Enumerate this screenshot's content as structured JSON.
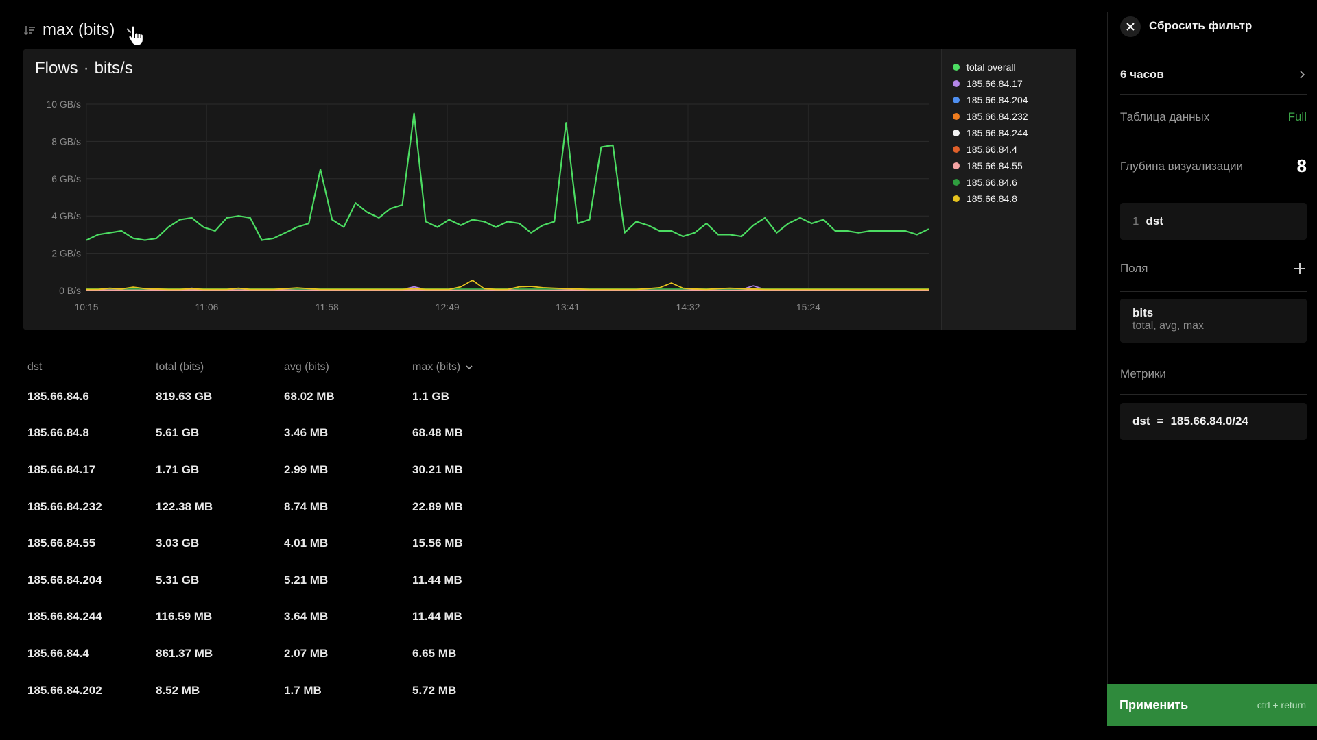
{
  "header": {
    "title": "max (bits)",
    "sort_icon": "sort-desc-icon",
    "chevron_icon": "chevron-down-icon"
  },
  "chart_data": {
    "type": "line",
    "title": "Flows",
    "unit": "bits/s",
    "x_ticks": [
      "10:15",
      "11:06",
      "11:58",
      "12:49",
      "13:41",
      "14:32",
      "15:24"
    ],
    "y_ticks": [
      "0 B/s",
      "2 GB/s",
      "4 GB/s",
      "6 GB/s",
      "8 GB/s",
      "10 GB/s"
    ],
    "ylim": [
      0,
      10
    ],
    "grid": true,
    "legend_position": "right",
    "series": [
      {
        "name": "total overall",
        "color": "#4cdc62",
        "values": [
          2.7,
          3.0,
          3.1,
          3.2,
          2.8,
          2.7,
          2.8,
          3.4,
          3.8,
          3.9,
          3.4,
          3.2,
          3.9,
          4.0,
          3.9,
          2.7,
          2.8,
          3.1,
          3.4,
          3.6,
          6.5,
          3.8,
          3.4,
          4.7,
          4.2,
          3.9,
          4.4,
          4.6,
          9.5,
          3.7,
          3.4,
          3.8,
          3.5,
          3.8,
          3.7,
          3.4,
          3.7,
          3.6,
          3.1,
          3.5,
          3.7,
          9.0,
          3.6,
          3.8,
          7.7,
          7.8,
          3.1,
          3.7,
          3.5,
          3.2,
          3.2,
          2.9,
          3.1,
          3.6,
          3.0,
          3.0,
          2.9,
          3.5,
          3.9,
          3.1,
          3.6,
          3.9,
          3.6,
          3.8,
          3.2,
          3.2,
          3.1,
          3.2,
          3.2,
          3.2,
          3.2,
          3.0,
          3.3
        ]
      },
      {
        "name": "185.66.84.17",
        "color": "#b486e8",
        "values": [
          0.05,
          0.05,
          0.08,
          0.05,
          0.06,
          0.05,
          0.1,
          0.05,
          0.05,
          0.12,
          0.05,
          0.06,
          0.05,
          0.08,
          0.05,
          0.05,
          0.05,
          0.07,
          0.05,
          0.05,
          0.05,
          0.05,
          0.05,
          0.05,
          0.05,
          0.05,
          0.05,
          0.05,
          0.2,
          0.05,
          0.05,
          0.05,
          0.05,
          0.05,
          0.05,
          0.05,
          0.05,
          0.05,
          0.05,
          0.05,
          0.05,
          0.05,
          0.05,
          0.05,
          0.05,
          0.05,
          0.05,
          0.05,
          0.05,
          0.05,
          0.05,
          0.05,
          0.08,
          0.05,
          0.05,
          0.05,
          0.05,
          0.25,
          0.05,
          0.05,
          0.05,
          0.05,
          0.05,
          0.05,
          0.05,
          0.05,
          0.05,
          0.05,
          0.05,
          0.05,
          0.05,
          0.05,
          0.05
        ]
      },
      {
        "name": "185.66.84.204",
        "color": "#4f8ff0",
        "values": [
          0.02,
          0.02,
          0.02,
          0.02,
          0.02,
          0.02,
          0.02,
          0.02,
          0.02,
          0.02,
          0.02,
          0.02,
          0.02,
          0.02,
          0.02,
          0.02,
          0.02,
          0.02,
          0.02,
          0.02,
          0.02,
          0.02,
          0.02,
          0.02,
          0.02,
          0.02,
          0.02,
          0.02,
          0.02,
          0.02,
          0.02,
          0.02,
          0.02,
          0.02,
          0.02,
          0.02,
          0.02,
          0.02,
          0.02,
          0.02,
          0.02,
          0.02,
          0.02,
          0.02,
          0.02,
          0.02,
          0.02,
          0.02,
          0.02,
          0.02,
          0.02,
          0.02,
          0.02,
          0.02,
          0.02,
          0.02,
          0.02,
          0.02,
          0.02,
          0.02,
          0.02,
          0.02,
          0.02,
          0.02,
          0.02,
          0.02,
          0.05,
          0.08,
          0.05,
          0.06,
          0.05,
          0.08,
          0.05
        ]
      },
      {
        "name": "185.66.84.232",
        "color": "#f07d1f",
        "values": [
          0.03,
          0.03,
          0.06,
          0.03,
          0.05,
          0.03,
          0.04,
          0.03,
          0.03,
          0.05,
          0.03,
          0.03,
          0.03,
          0.05,
          0.03,
          0.03,
          0.03,
          0.04,
          0.03,
          0.03,
          0.03,
          0.03,
          0.03,
          0.03,
          0.03,
          0.03,
          0.03,
          0.03,
          0.05,
          0.03,
          0.03,
          0.03,
          0.03,
          0.03,
          0.03,
          0.03,
          0.04,
          0.03,
          0.03,
          0.03,
          0.03,
          0.05,
          0.03,
          0.03,
          0.03,
          0.03,
          0.03,
          0.03,
          0.03,
          0.03,
          0.03,
          0.03,
          0.05,
          0.03,
          0.03,
          0.03,
          0.03,
          0.04,
          0.03,
          0.03,
          0.03,
          0.03,
          0.03,
          0.03,
          0.03,
          0.03,
          0.03,
          0.03,
          0.03,
          0.03,
          0.03,
          0.03,
          0.03
        ]
      },
      {
        "name": "185.66.84.244",
        "color": "#f2f2f2",
        "values": [
          0.02,
          0.02,
          0.02,
          0.02,
          0.02,
          0.02,
          0.02,
          0.02,
          0.02,
          0.02,
          0.02,
          0.02,
          0.02,
          0.02,
          0.02,
          0.02,
          0.02,
          0.02,
          0.02,
          0.02,
          0.02,
          0.02,
          0.02,
          0.02,
          0.02,
          0.02,
          0.02,
          0.02,
          0.02,
          0.02,
          0.02,
          0.02,
          0.02,
          0.02,
          0.02,
          0.02,
          0.02,
          0.02,
          0.02,
          0.02,
          0.02,
          0.02,
          0.02,
          0.02,
          0.02,
          0.02,
          0.02,
          0.02,
          0.02,
          0.02,
          0.02,
          0.02,
          0.02,
          0.02,
          0.02,
          0.02,
          0.02,
          0.02,
          0.02,
          0.02,
          0.02,
          0.02,
          0.02,
          0.02,
          0.02,
          0.02,
          0.02,
          0.02,
          0.02,
          0.02,
          0.02,
          0.02,
          0.02
        ]
      },
      {
        "name": "185.66.84.4",
        "color": "#e0602a",
        "values": [
          0.04,
          0.04,
          0.04,
          0.04,
          0.04,
          0.04,
          0.04,
          0.04,
          0.04,
          0.04,
          0.04,
          0.04,
          0.04,
          0.04,
          0.04,
          0.04,
          0.04,
          0.04,
          0.04,
          0.04,
          0.04,
          0.04,
          0.04,
          0.04,
          0.04,
          0.04,
          0.04,
          0.04,
          0.04,
          0.04,
          0.04,
          0.04,
          0.04,
          0.04,
          0.04,
          0.04,
          0.04,
          0.04,
          0.04,
          0.04,
          0.04,
          0.04,
          0.04,
          0.04,
          0.04,
          0.04,
          0.04,
          0.04,
          0.04,
          0.04,
          0.04,
          0.04,
          0.04,
          0.04,
          0.04,
          0.04,
          0.04,
          0.04,
          0.04,
          0.04,
          0.04,
          0.04,
          0.04,
          0.04,
          0.04,
          0.04,
          0.04,
          0.04,
          0.04,
          0.04,
          0.04,
          0.04,
          0.04
        ]
      },
      {
        "name": "185.66.84.55",
        "color": "#f4a3a3",
        "values": [
          0.03,
          0.03,
          0.03,
          0.03,
          0.03,
          0.03,
          0.03,
          0.03,
          0.03,
          0.03,
          0.03,
          0.03,
          0.03,
          0.03,
          0.03,
          0.03,
          0.03,
          0.03,
          0.03,
          0.03,
          0.03,
          0.03,
          0.03,
          0.03,
          0.03,
          0.03,
          0.03,
          0.03,
          0.03,
          0.03,
          0.03,
          0.03,
          0.03,
          0.03,
          0.03,
          0.03,
          0.03,
          0.03,
          0.03,
          0.03,
          0.03,
          0.03,
          0.03,
          0.03,
          0.03,
          0.03,
          0.03,
          0.03,
          0.03,
          0.03,
          0.03,
          0.03,
          0.03,
          0.03,
          0.03,
          0.03,
          0.03,
          0.03,
          0.03,
          0.03,
          0.03,
          0.03,
          0.03,
          0.03,
          0.03,
          0.03,
          0.03,
          0.03,
          0.03,
          0.03,
          0.03,
          0.03,
          0.03
        ]
      },
      {
        "name": "185.66.84.6",
        "color": "#2f9e3f",
        "values": [
          0.08,
          0.08,
          0.1,
          0.08,
          0.09,
          0.08,
          0.1,
          0.08,
          0.08,
          0.1,
          0.08,
          0.08,
          0.08,
          0.1,
          0.08,
          0.08,
          0.08,
          0.1,
          0.08,
          0.08,
          0.08,
          0.08,
          0.08,
          0.08,
          0.08,
          0.08,
          0.08,
          0.08,
          0.1,
          0.08,
          0.08,
          0.08,
          0.08,
          0.08,
          0.08,
          0.08,
          0.1,
          0.08,
          0.08,
          0.08,
          0.08,
          0.1,
          0.08,
          0.08,
          0.08,
          0.08,
          0.08,
          0.08,
          0.08,
          0.08,
          0.08,
          0.08,
          0.1,
          0.08,
          0.08,
          0.08,
          0.08,
          0.1,
          0.08,
          0.08,
          0.08,
          0.08,
          0.08,
          0.08,
          0.08,
          0.08,
          0.08,
          0.08,
          0.08,
          0.08,
          0.08,
          0.08,
          0.08
        ]
      },
      {
        "name": "185.66.84.8",
        "color": "#e7c31e",
        "values": [
          0.06,
          0.06,
          0.12,
          0.08,
          0.18,
          0.1,
          0.08,
          0.06,
          0.06,
          0.1,
          0.06,
          0.06,
          0.06,
          0.12,
          0.06,
          0.06,
          0.06,
          0.1,
          0.14,
          0.1,
          0.06,
          0.06,
          0.06,
          0.06,
          0.06,
          0.06,
          0.06,
          0.06,
          0.1,
          0.06,
          0.06,
          0.06,
          0.2,
          0.55,
          0.1,
          0.06,
          0.06,
          0.2,
          0.22,
          0.15,
          0.12,
          0.1,
          0.08,
          0.06,
          0.06,
          0.06,
          0.06,
          0.06,
          0.1,
          0.15,
          0.4,
          0.12,
          0.08,
          0.06,
          0.1,
          0.12,
          0.1,
          0.08,
          0.06,
          0.06,
          0.06,
          0.06,
          0.06,
          0.06,
          0.06,
          0.06,
          0.06,
          0.06,
          0.06,
          0.06,
          0.06,
          0.06,
          0.06
        ]
      }
    ]
  },
  "table": {
    "headers": [
      "dst",
      "total (bits)",
      "avg (bits)",
      "max (bits)"
    ],
    "sort_icon": "chevron-down-icon",
    "rows": [
      [
        "185.66.84.6",
        "819.63 GB",
        "68.02 MB",
        "1.1 GB"
      ],
      [
        "185.66.84.8",
        "5.61 GB",
        "3.46 MB",
        "68.48 MB"
      ],
      [
        "185.66.84.17",
        "1.71 GB",
        "2.99 MB",
        "30.21 MB"
      ],
      [
        "185.66.84.232",
        "122.38 MB",
        "8.74 MB",
        "22.89 MB"
      ],
      [
        "185.66.84.55",
        "3.03 GB",
        "4.01 MB",
        "15.56 MB"
      ],
      [
        "185.66.84.204",
        "5.31 GB",
        "5.21 MB",
        "11.44 MB"
      ],
      [
        "185.66.84.244",
        "116.59 MB",
        "3.64 MB",
        "11.44 MB"
      ],
      [
        "185.66.84.4",
        "861.37 MB",
        "2.07 MB",
        "6.65 MB"
      ],
      [
        "185.66.84.202",
        "8.52 MB",
        "1.7 MB",
        "5.72 MB"
      ]
    ]
  },
  "sidebar": {
    "reset_filter": "Сбросить фильтр",
    "period": "6 часов",
    "data_table_label": "Таблица данных",
    "data_table_value": "Full",
    "depth_label": "Глубина визуализации",
    "depth_value": "8",
    "group_index": "1",
    "group_value": "dst",
    "fields_label": "Поля",
    "field_name": "bits",
    "field_aggs": "total, avg, max",
    "metrics_label": "Метрики",
    "filter_key": "dst",
    "filter_op": "=",
    "filter_value": "185.66.84.0/24",
    "apply_label": "Применить",
    "apply_hint": "ctrl + return",
    "accent_color": "#2f8a3c"
  }
}
